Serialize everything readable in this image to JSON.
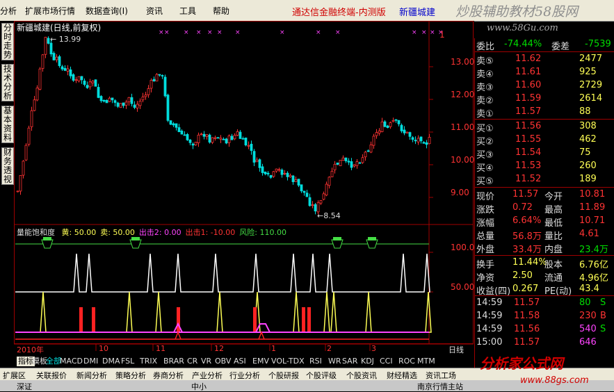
{
  "menubar": {
    "items": [
      "分析",
      "扩展市场行情",
      "数据查询(I)",
      "资讯",
      "工具",
      "帮助"
    ],
    "app_title": "通达信金融终端-内测版",
    "stock_title": "新疆城建",
    "banner": "炒股辅助教材58股网"
  },
  "website": "www.58Gu.com",
  "left_tabs": [
    "分时走势",
    "技术分析",
    "基本资料",
    "财务透视"
  ],
  "chart": {
    "title": "新疆城建(日线,前复权)",
    "high_label": "13.99",
    "low_label": "8.54",
    "price_axis": [
      "13.00",
      "12.00",
      "11.00",
      "10.00",
      "9.00"
    ],
    "ind_axis": [
      "100.0",
      "50.00"
    ],
    "x_labels": [
      "2010年",
      "10",
      "11",
      "12",
      "1",
      "2",
      "3"
    ],
    "x_unit": "日线"
  },
  "indicator": {
    "name": "量能饱和度",
    "items": [
      {
        "text": "黄: 50.00",
        "color": "#ffff55"
      },
      {
        "text": "卖: 50.00",
        "color": "#ffff55"
      },
      {
        "text": "出击2: 0.00",
        "color": "#ff44ff"
      },
      {
        "text": "出击1: -10.00",
        "color": "#ff3333"
      },
      {
        "text": "风险: 110.00",
        "color": "#44dd44"
      }
    ]
  },
  "quote": {
    "webi_label": "委比",
    "webi": "-74.44%",
    "weicha_label": "委差",
    "weicha": "-7539",
    "sells": [
      {
        "label": "卖⑤",
        "price": "11.62",
        "vol": "2477"
      },
      {
        "label": "卖④",
        "price": "11.61",
        "vol": "925"
      },
      {
        "label": "卖③",
        "price": "11.60",
        "vol": "2729"
      },
      {
        "label": "卖②",
        "price": "11.59",
        "vol": "2614"
      },
      {
        "label": "卖①",
        "price": "11.57",
        "vol": "88"
      }
    ],
    "buys": [
      {
        "label": "买①",
        "price": "11.56",
        "vol": "308"
      },
      {
        "label": "买②",
        "price": "11.55",
        "vol": "462"
      },
      {
        "label": "买③",
        "price": "11.54",
        "vol": "75"
      },
      {
        "label": "买④",
        "price": "11.53",
        "vol": "260"
      },
      {
        "label": "买⑤",
        "price": "11.52",
        "vol": "189"
      }
    ],
    "stats": [
      [
        "现价",
        "11.57",
        "今开",
        "10.81"
      ],
      [
        "涨跌",
        "0.72",
        "最高",
        "11.89"
      ],
      [
        "涨幅",
        "6.64%",
        "最低",
        "10.71"
      ],
      [
        "总量",
        "56.8万",
        "量比",
        "4.61"
      ],
      [
        "外盘",
        "33.4万",
        "内盘",
        "23.4万"
      ]
    ],
    "stats2": [
      [
        "换手",
        "11.44%",
        "股本",
        "6.76亿"
      ],
      [
        "净资",
        "2.50",
        "流通",
        "4.96亿"
      ],
      [
        "收益(四)",
        "0.267",
        "PE(动)",
        "43.4"
      ]
    ],
    "ticks": [
      {
        "time": "14:59",
        "price": "11.57",
        "vol": "80",
        "flag": "S"
      },
      {
        "time": "14:59",
        "price": "11.58",
        "vol": "230",
        "flag": "B"
      },
      {
        "time": "14:59",
        "price": "11.56",
        "vol": "540",
        "flag": "S"
      },
      {
        "time": "15:00",
        "price": "11.57",
        "vol": "646",
        "flag": ""
      }
    ]
  },
  "bottom_tabs": [
    "指标",
    "模板",
    "全部",
    "MACD",
    "DMI",
    "DMA",
    "FSL",
    "TRIX",
    "BRAR",
    "CR",
    "VR",
    "OBV",
    "ASI",
    "EMV",
    "VOL-TDX",
    "RSI",
    "WR",
    "SAR",
    "KDJ",
    "CCI",
    "ROC",
    "MTM"
  ],
  "bottom_tabs2": [
    "扩展区",
    "关联报价",
    "新闻分析",
    "策略分析",
    "券商分析",
    "产业分析",
    "行业分析",
    "个股研报",
    "个股评级",
    "个股资讯",
    "财经精选",
    "资讯工场"
  ],
  "status": {
    "text1": "深证",
    "text2": "中小",
    "text3": "南京行情主站"
  },
  "watermark": "分析家公式网",
  "watermark_site": "www.88gs.com",
  "colors": {
    "up": "#ff3333",
    "down": "#00dddd",
    "bg": "#000000",
    "border": "#a00000"
  }
}
